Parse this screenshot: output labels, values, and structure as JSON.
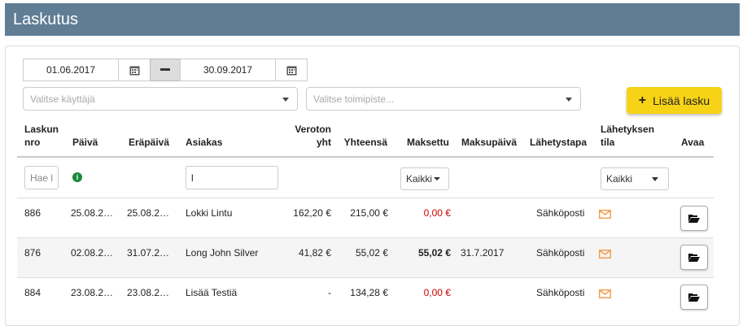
{
  "header": {
    "title": "Laskutus"
  },
  "filters": {
    "date_from": "01.06.2017",
    "date_to": "30.09.2017",
    "user_placeholder": "Valitse käyttäjä",
    "office_placeholder": "Valitse toimipiste...",
    "add_label": "Lisää lasku"
  },
  "table": {
    "headers": {
      "nro_1": "Laskun",
      "nro_2": "nro",
      "paiva": "Päivä",
      "erapaiva": "Eräpäivä",
      "asiakas": "Asiakas",
      "veroton_1": "Veroton",
      "veroton_2": "yht",
      "yhteensa": "Yhteensä",
      "maksettu": "Maksettu",
      "maksupaiva": "Maksupäivä",
      "lahetystapa": "Lähetystapa",
      "tila_1": "Lähetyksen",
      "tila_2": "tila",
      "avaa": "Avaa"
    },
    "filter_row": {
      "nro_placeholder": "Hae l",
      "asiakas_value": "l",
      "maksettu_select": "Kaikki",
      "tila_select": "Kaikki"
    },
    "rows": [
      {
        "nro": "886",
        "paiva": "25.08.2…",
        "erapaiva": "25.08.2…",
        "asiakas": "Lokki Lintu",
        "veroton": "162,20 €",
        "yhteensa": "215,00 €",
        "maksettu": "0,00 €",
        "maksupaiva": "",
        "lahetystapa": "Sähköposti"
      },
      {
        "nro": "876",
        "paiva": "02.08.2…",
        "erapaiva": "31.07.2…",
        "asiakas": "Long John Silver",
        "veroton": "41,82 €",
        "yhteensa": "55,02 €",
        "maksettu": "55,02 €",
        "maksupaiva": "31.7.2017",
        "lahetystapa": "Sähköposti"
      },
      {
        "nro": "884",
        "paiva": "23.08.2…",
        "erapaiva": "23.08.2…",
        "asiakas": "Lisää Testiä",
        "veroton": "-",
        "yhteensa": "134,28 €",
        "maksettu": "0,00 €",
        "maksupaiva": "",
        "lahetystapa": "Sähköposti"
      }
    ]
  },
  "colors": {
    "header_bg": "#607d96",
    "add_button": "#f7d317",
    "unpaid": "#cc0000",
    "mail_icon": "#f0a050"
  },
  "icons": {
    "calendar": "calendar-icon",
    "minus": "minus-icon",
    "plus": "plus-icon",
    "info": "info-icon",
    "mail": "envelope-icon",
    "folder": "folder-open-icon"
  }
}
